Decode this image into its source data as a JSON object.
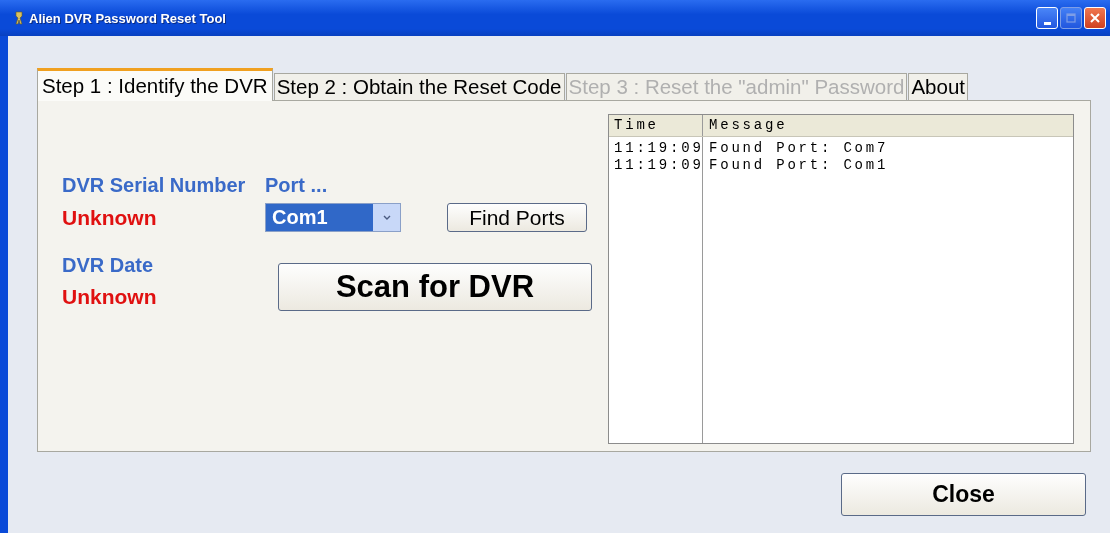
{
  "window": {
    "title": "Alien DVR Password Reset Tool"
  },
  "tabs": [
    {
      "label": "Step 1 : Identify the DVR",
      "selected": true,
      "disabled": false
    },
    {
      "label": "Step 2 : Obtain the Reset Code",
      "selected": false,
      "disabled": false
    },
    {
      "label": "Step 3 : Reset the \"admin\" Password",
      "selected": false,
      "disabled": true
    },
    {
      "label": "About",
      "selected": false,
      "disabled": false
    }
  ],
  "serial": {
    "label": "DVR Serial Number",
    "value": "Unknown"
  },
  "port": {
    "label": "Port ...",
    "value": "Com1"
  },
  "find_button": "Find Ports",
  "date": {
    "label": "DVR Date",
    "value": "Unknown"
  },
  "scan_button": "Scan for DVR",
  "log": {
    "columns": [
      "Time",
      "Message"
    ],
    "rows": [
      {
        "time": "11:19:09",
        "message": "Found Port: Com7"
      },
      {
        "time": "11:19:09",
        "message": "Found Port: Com1"
      }
    ]
  },
  "close_button": "Close"
}
